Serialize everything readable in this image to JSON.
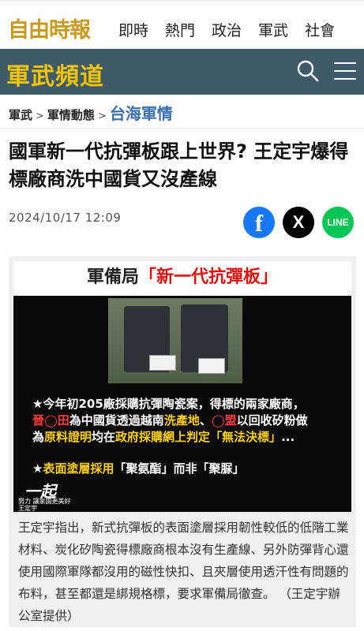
{
  "header": {
    "logo_text": "自由時報",
    "nav": [
      "即時",
      "熱門",
      "政治",
      "軍武",
      "社會"
    ]
  },
  "channel": {
    "title": "軍武頻道",
    "search_icon": "search-icon",
    "menu_icon": "hamburger-menu-icon"
  },
  "breadcrumb": {
    "items": [
      "軍武",
      "軍情動態"
    ],
    "separator": ">",
    "current": "台海軍情"
  },
  "article": {
    "title": "國軍新一代抗彈板跟上世界? 王定宇爆得標廠商洗中國貨又沒產線",
    "date": "2024/10/17 12:09",
    "share": {
      "facebook_icon": "f",
      "x_icon": "X",
      "line_label": "LINE"
    }
  },
  "image": {
    "header_black": "軍備局",
    "header_red": "「新一代抗彈板」",
    "line1": "★今年初205廠採購抗彈陶瓷案，得標的兩家廠商，",
    "line2_a": "晉◯田",
    "line2_b": "為中國貨透過越南",
    "line2_c": "洗產地",
    "line2_d": "、",
    "line2_e": "◯盟",
    "line2_f": "以回收矽粉做",
    "line3_a": "為",
    "line3_b": "原料證明",
    "line3_c": "均在",
    "line3_d": "政府採購網上判定「無法決標」",
    "line3_e": "...",
    "line4_a": "★",
    "line4_b": "表面塗層採用",
    "line4_c": "「聚氨酯」而非「聚脲」",
    "stamp_big": "一起",
    "stamp_small": "努力 讓家園更美好 王定宇",
    "plate_labels": [
      "",
      ""
    ]
  },
  "caption": "王定宇指出，新式抗彈板的表面塗層採用韌性較低的低階工業材料、炭化矽陶瓷得標廠商根本沒有生產線、另外防彈背心還使用國際軍隊都沒用的磁性快扣、且夾層使用透汗性有問題的布料，甚至都還是綁規格標，要求軍備局徹查。 （王定宇辦公室提供）",
  "colors": {
    "brand_gold": "#c99a1f",
    "channel_bg": "#3f5b69",
    "channel_title": "#f4c400",
    "crumb_current": "#3e6fb0"
  }
}
